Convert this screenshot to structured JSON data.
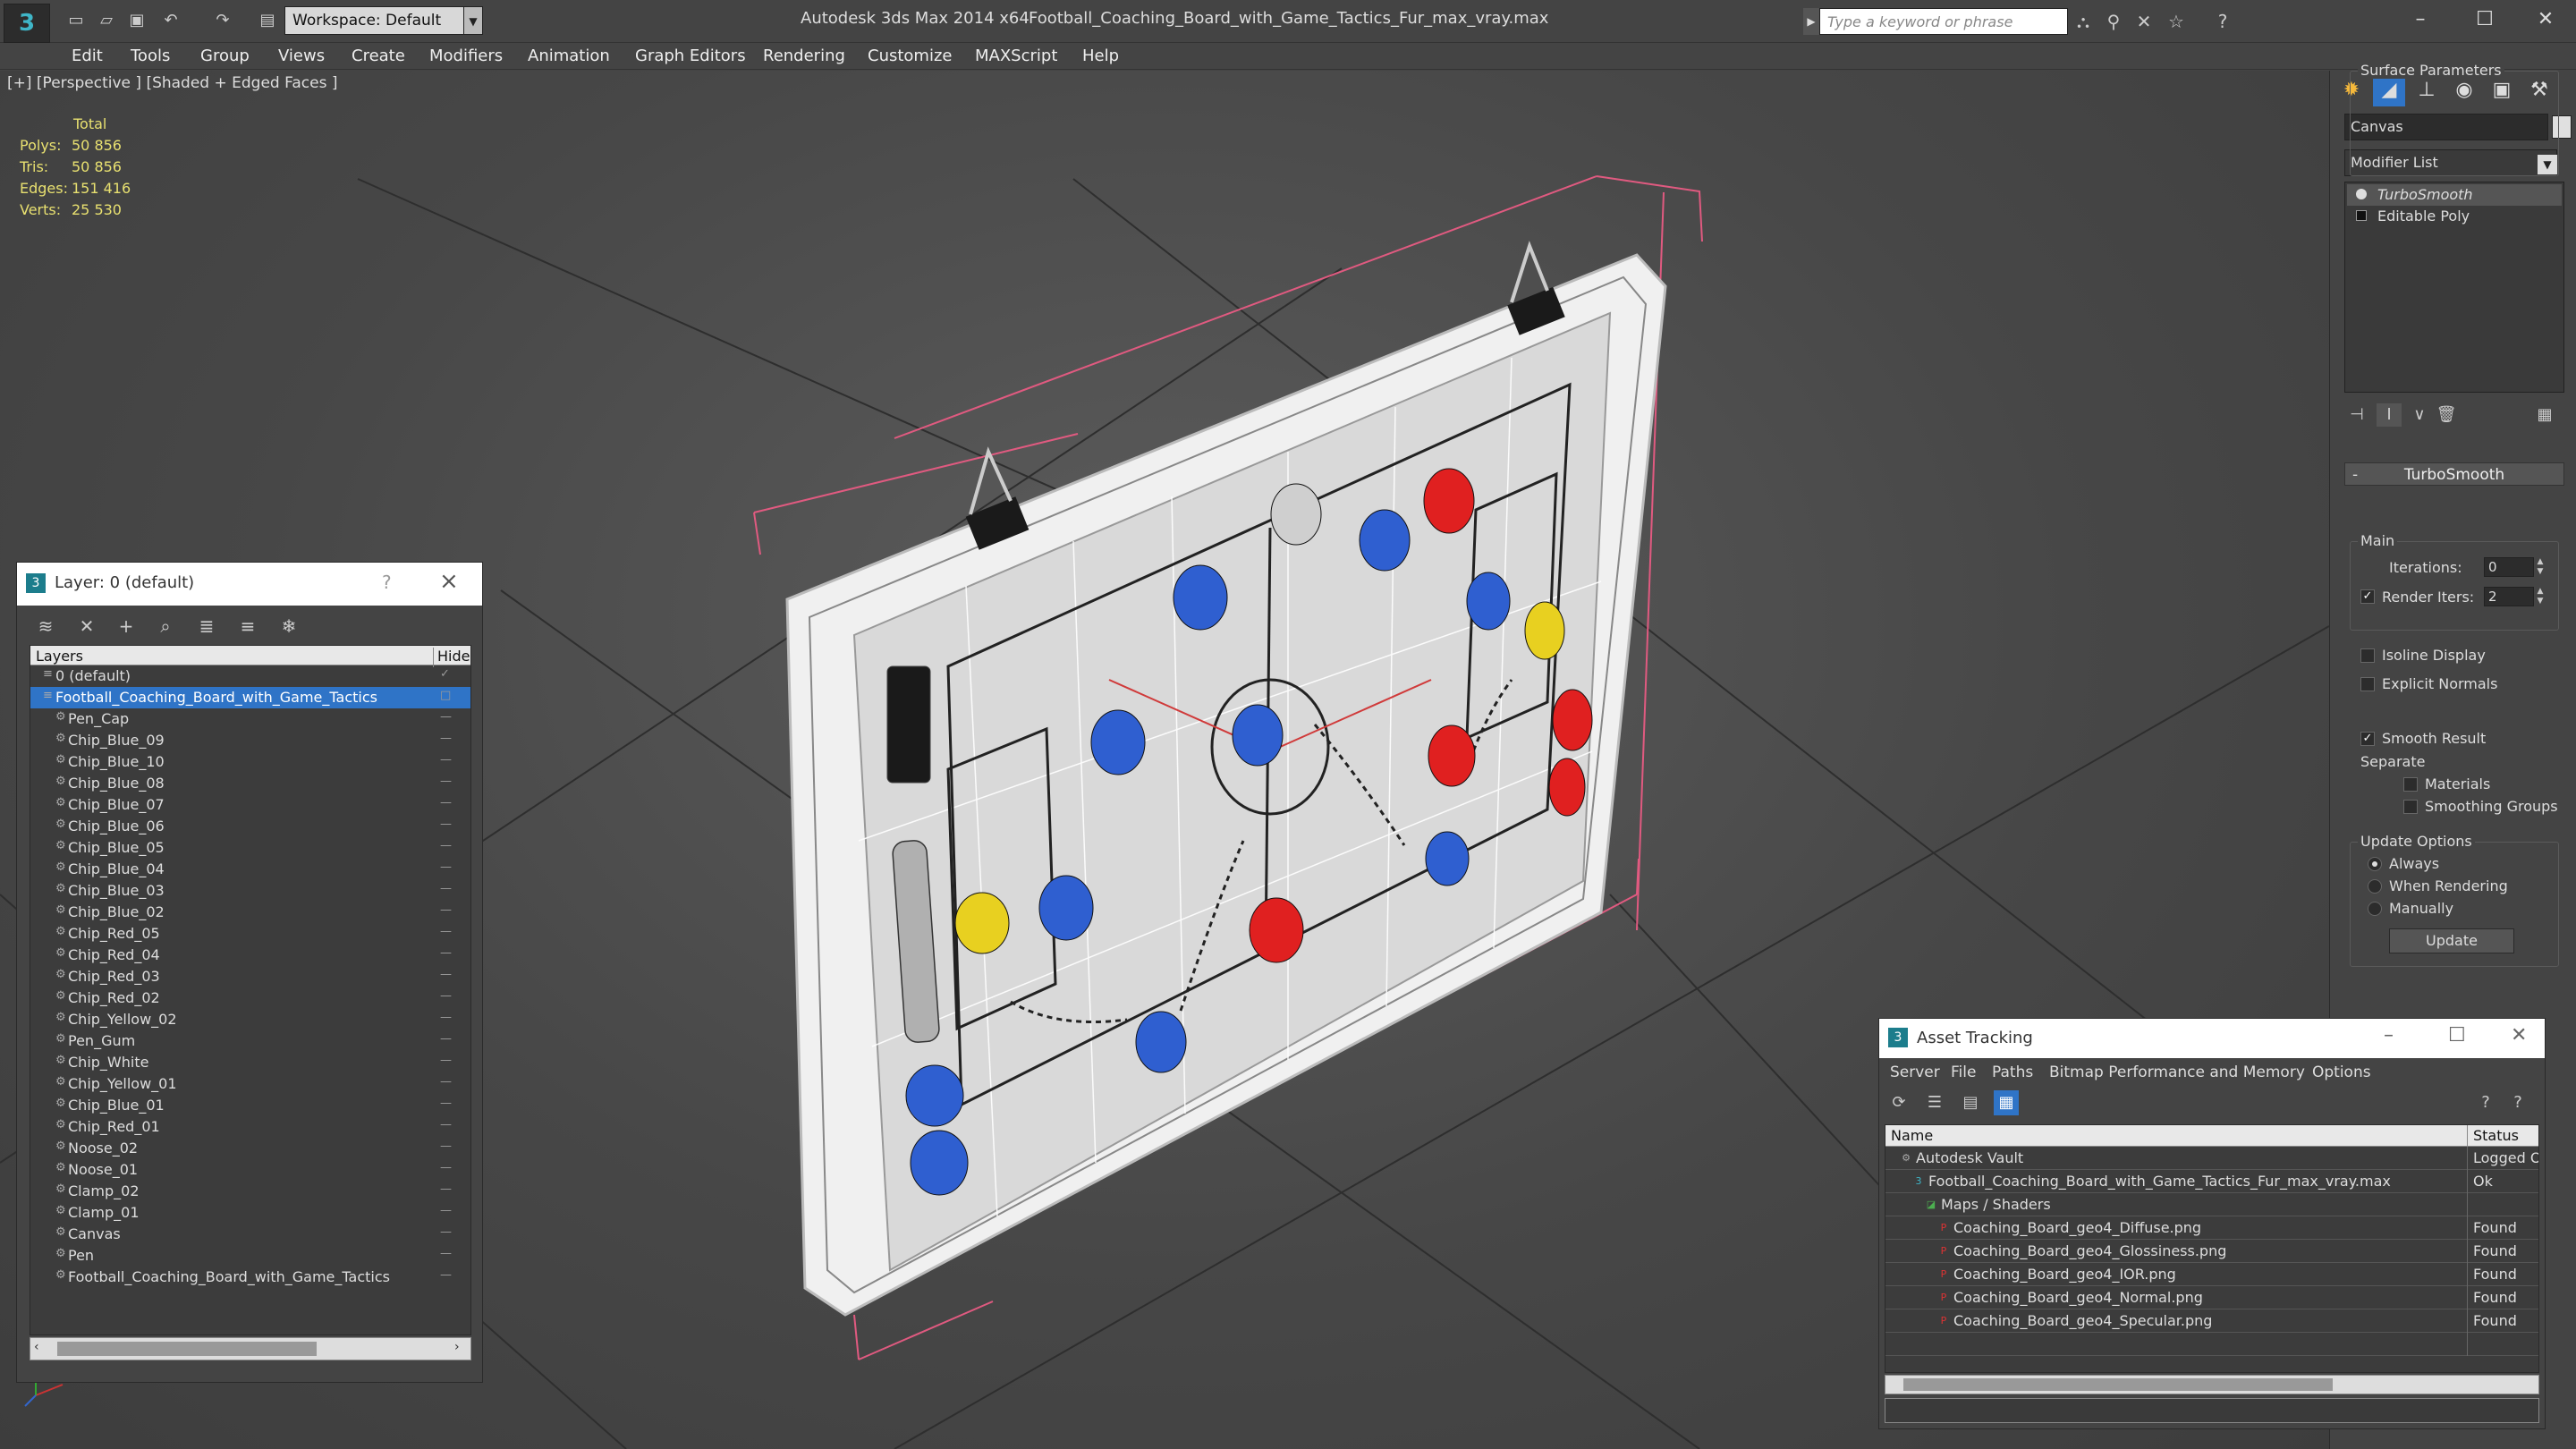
{
  "app": {
    "title": "Autodesk 3ds Max 2014 x64",
    "file": "Football_Coaching_Board_with_Game_Tactics_Fur_max_vray.max",
    "workspace": "Workspace: Default",
    "search_placeholder": "Type a keyword or phrase"
  },
  "menu": [
    "Edit",
    "Tools",
    "Group",
    "Views",
    "Create",
    "Modifiers",
    "Animation",
    "Graph Editors",
    "Rendering",
    "Customize",
    "MAXScript",
    "Help"
  ],
  "viewport": {
    "label": "[+] [Perspective ] [Shaded + Edged Faces ]",
    "stats": {
      "header": "Total",
      "rows": [
        {
          "key": "Polys:",
          "value": "50 856"
        },
        {
          "key": "Tris:",
          "value": "50 856"
        },
        {
          "key": "Edges:",
          "value": "151 416"
        },
        {
          "key": "Verts:",
          "value": "25 530"
        }
      ]
    }
  },
  "layer_panel": {
    "title": "Layer: 0 (default)",
    "help": "?",
    "col_layers": "Layers",
    "col_hide": "Hide",
    "rows": [
      {
        "name": "0 (default)",
        "level": 0,
        "kind": "layer",
        "checked": true
      },
      {
        "name": "Football_Coaching_Board_with_Game_Tactics",
        "level": 0,
        "kind": "layer",
        "selected": true
      },
      {
        "name": "Pen_Cap",
        "level": 1,
        "kind": "object"
      },
      {
        "name": "Chip_Blue_09",
        "level": 1,
        "kind": "object"
      },
      {
        "name": "Chip_Blue_10",
        "level": 1,
        "kind": "object"
      },
      {
        "name": "Chip_Blue_08",
        "level": 1,
        "kind": "object"
      },
      {
        "name": "Chip_Blue_07",
        "level": 1,
        "kind": "object"
      },
      {
        "name": "Chip_Blue_06",
        "level": 1,
        "kind": "object"
      },
      {
        "name": "Chip_Blue_05",
        "level": 1,
        "kind": "object"
      },
      {
        "name": "Chip_Blue_04",
        "level": 1,
        "kind": "object"
      },
      {
        "name": "Chip_Blue_03",
        "level": 1,
        "kind": "object"
      },
      {
        "name": "Chip_Blue_02",
        "level": 1,
        "kind": "object"
      },
      {
        "name": "Chip_Red_05",
        "level": 1,
        "kind": "object"
      },
      {
        "name": "Chip_Red_04",
        "level": 1,
        "kind": "object"
      },
      {
        "name": "Chip_Red_03",
        "level": 1,
        "kind": "object"
      },
      {
        "name": "Chip_Red_02",
        "level": 1,
        "kind": "object"
      },
      {
        "name": "Chip_Yellow_02",
        "level": 1,
        "kind": "object"
      },
      {
        "name": "Pen_Gum",
        "level": 1,
        "kind": "object"
      },
      {
        "name": "Chip_White",
        "level": 1,
        "kind": "object"
      },
      {
        "name": "Chip_Yellow_01",
        "level": 1,
        "kind": "object"
      },
      {
        "name": "Chip_Blue_01",
        "level": 1,
        "kind": "object"
      },
      {
        "name": "Chip_Red_01",
        "level": 1,
        "kind": "object"
      },
      {
        "name": "Noose_02",
        "level": 1,
        "kind": "object"
      },
      {
        "name": "Noose_01",
        "level": 1,
        "kind": "object"
      },
      {
        "name": "Clamp_02",
        "level": 1,
        "kind": "object"
      },
      {
        "name": "Clamp_01",
        "level": 1,
        "kind": "object"
      },
      {
        "name": "Canvas",
        "level": 1,
        "kind": "object"
      },
      {
        "name": "Pen",
        "level": 1,
        "kind": "object"
      },
      {
        "name": "Football_Coaching_Board_with_Game_Tactics",
        "level": 1,
        "kind": "object"
      }
    ]
  },
  "command_panel": {
    "object_name": "Canvas",
    "modifier_list": "Modifier List",
    "stack": [
      "TurboSmooth",
      "Editable Poly"
    ],
    "rollout": "TurboSmooth",
    "main_group": "Main",
    "iterations_label": "Iterations:",
    "iterations_value": "0",
    "render_iters_label": "Render Iters:",
    "render_iters_value": "2",
    "isoline_label": "Isoline Display",
    "explicit_label": "Explicit Normals",
    "surface_group": "Surface Parameters",
    "smooth_label": "Smooth Result",
    "separate_label": "Separate",
    "materials_label": "Materials",
    "smoothing_label": "Smoothing Groups",
    "update_group": "Update Options",
    "always_label": "Always",
    "when_rendering_label": "When Rendering",
    "manually_label": "Manually",
    "update_button": "Update"
  },
  "asset_tracking": {
    "title": "Asset Tracking",
    "menu": [
      "Server",
      "File",
      "Paths",
      "Bitmap Performance and Memory",
      "Options"
    ],
    "col_name": "Name",
    "col_status": "Status",
    "rows": [
      {
        "name": "Autodesk Vault",
        "status": "Logged O",
        "level": 0,
        "icon": "vault"
      },
      {
        "name": "Football_Coaching_Board_with_Game_Tactics_Fur_max_vray.max",
        "status": "Ok",
        "level": 1,
        "icon": "max"
      },
      {
        "name": "Maps / Shaders",
        "status": "",
        "level": 2,
        "icon": "maps"
      },
      {
        "name": "Coaching_Board_geo4_Diffuse.png",
        "status": "Found",
        "level": 3,
        "icon": "png"
      },
      {
        "name": "Coaching_Board_geo4_Glossiness.png",
        "status": "Found",
        "level": 3,
        "icon": "png"
      },
      {
        "name": "Coaching_Board_geo4_IOR.png",
        "status": "Found",
        "level": 3,
        "icon": "png"
      },
      {
        "name": "Coaching_Board_geo4_Normal.png",
        "status": "Found",
        "level": 3,
        "icon": "png"
      },
      {
        "name": "Coaching_Board_geo4_Specular.png",
        "status": "Found",
        "level": 3,
        "icon": "png"
      },
      {
        "name": "",
        "status": "",
        "level": 0,
        "icon": ""
      }
    ]
  }
}
